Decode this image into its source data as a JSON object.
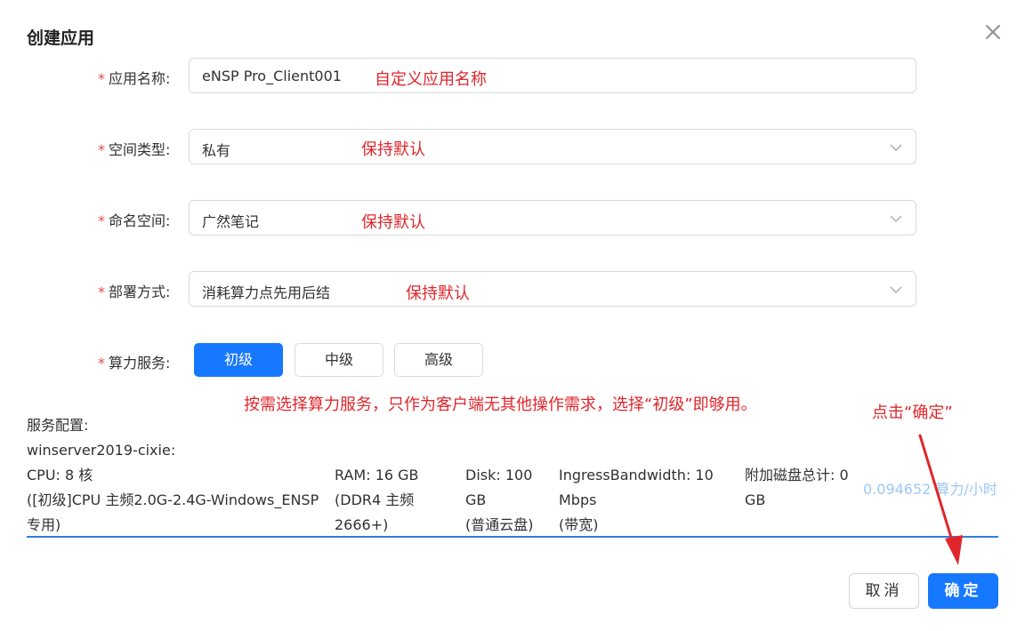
{
  "dialog": {
    "title": "创建应用",
    "fields": {
      "app_name": {
        "label": "应用名称:",
        "value": "eNSP Pro_Client001",
        "note": "自定义应用名称"
      },
      "space_type": {
        "label": "空间类型:",
        "value": "私有",
        "note": "保持默认"
      },
      "namespace": {
        "label": "命名空间:",
        "value": "广然笔记",
        "note": "保持默认"
      },
      "deploy_mode": {
        "label": "部署方式:",
        "value": "消耗算力点先用后结",
        "note": "保持默认"
      },
      "compute": {
        "label": "算力服务:",
        "options": [
          "初级",
          "中级",
          "高级"
        ],
        "selected": "初级",
        "note": "按需选择算力服务，只作为客户端无其他操作需求，选择“初级”即够用。"
      }
    },
    "service_config": {
      "heading": "服务配置:",
      "image": "winserver2019-cixie:",
      "cpu": [
        "CPU: 8 核",
        "([初级]CPU 主频2.0G-2.4G-Windows_ENSP",
        "专用)"
      ],
      "ram": [
        "RAM: 16 GB",
        "(DDR4 主频",
        "2666+)"
      ],
      "disk": [
        "Disk: 100",
        "GB",
        "(普通云盘)"
      ],
      "bandwidth": [
        "IngressBandwidth: 10",
        "Mbps",
        "(带宽)"
      ],
      "extra_disk": [
        "附加磁盘总计: 0",
        "GB"
      ],
      "price": "0.094652 算力/小时"
    },
    "confirm_note": "点击“确定”",
    "buttons": {
      "cancel": "取消",
      "ok": "确定"
    }
  },
  "colors": {
    "primary": "#1677ff",
    "annotation": "#e0262c",
    "required": "#e5484d",
    "divider": "#2f7fd8"
  },
  "icons": {
    "close": "close-icon",
    "select": "chevron-down-icon",
    "annotation_arrow": "red-arrow-icon"
  }
}
